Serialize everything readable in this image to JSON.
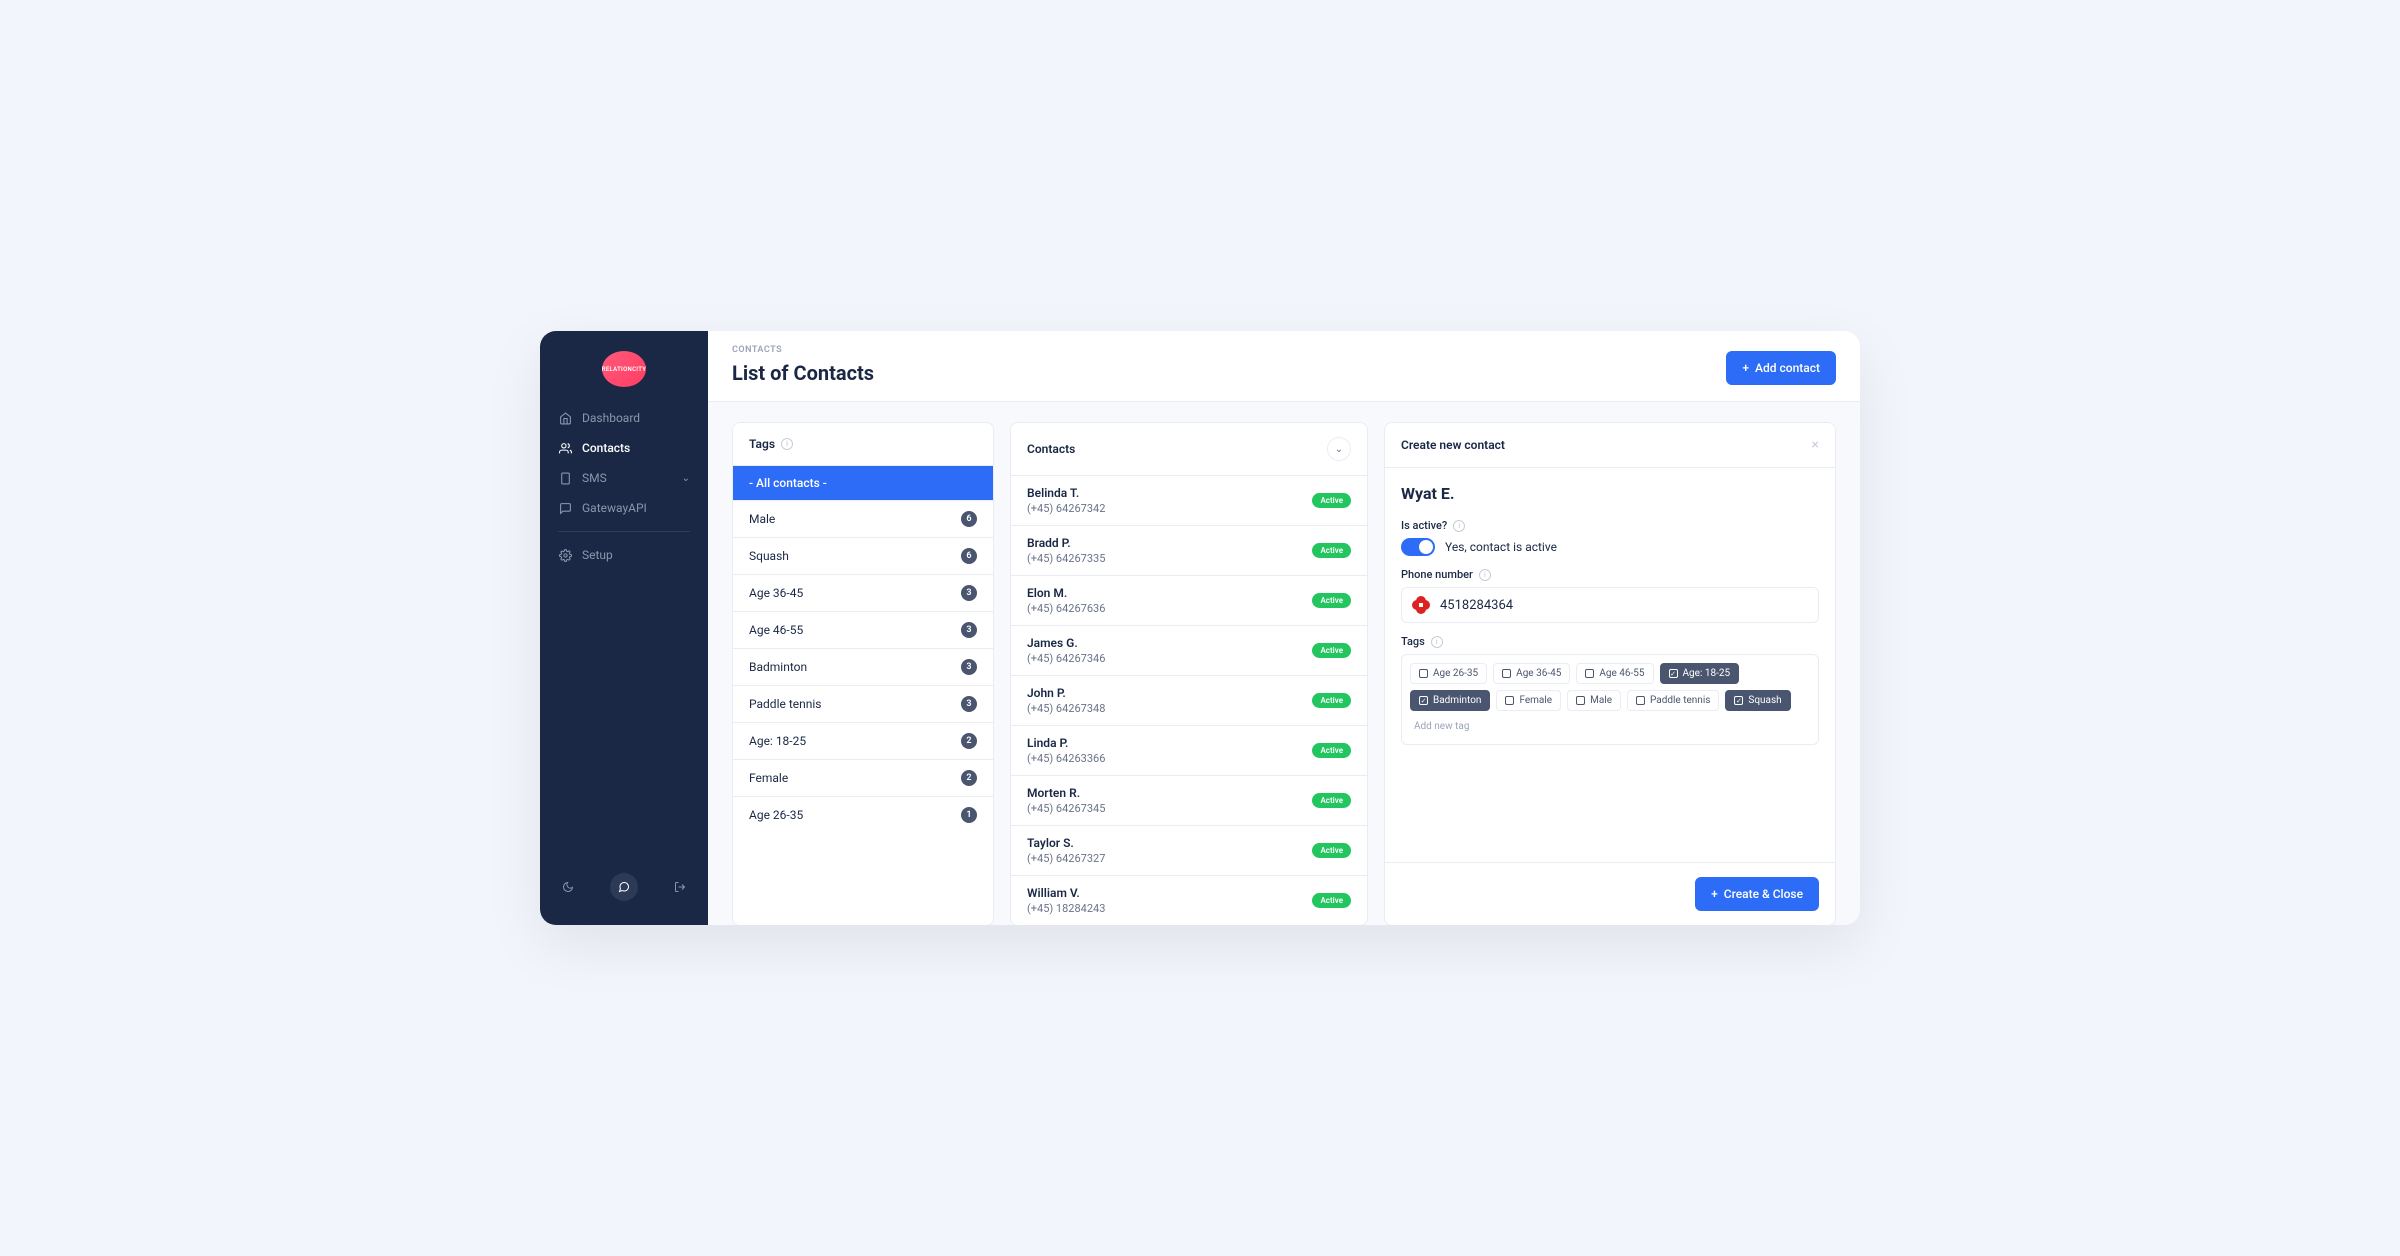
{
  "brand": "RELATIONCITY",
  "sidebar": {
    "items": [
      {
        "label": "Dashboard",
        "icon": "home"
      },
      {
        "label": "Contacts",
        "icon": "people",
        "active": true
      },
      {
        "label": "SMS",
        "icon": "phone",
        "expandable": true
      },
      {
        "label": "GatewayAPI",
        "icon": "chat"
      }
    ],
    "setup": "Setup"
  },
  "header": {
    "breadcrumb": "CONTACTS",
    "title": "List of Contacts",
    "add_button": "Add contact"
  },
  "tags_panel": {
    "title": "Tags",
    "items": [
      {
        "label": "- All contacts -",
        "active": true
      },
      {
        "label": "Male",
        "count": "6"
      },
      {
        "label": "Squash",
        "count": "6"
      },
      {
        "label": "Age 36-45",
        "count": "3"
      },
      {
        "label": "Age 46-55",
        "count": "3"
      },
      {
        "label": "Badminton",
        "count": "3"
      },
      {
        "label": "Paddle tennis",
        "count": "3"
      },
      {
        "label": "Age: 18-25",
        "count": "2"
      },
      {
        "label": "Female",
        "count": "2"
      },
      {
        "label": "Age 26-35",
        "count": "1"
      }
    ]
  },
  "contacts_panel": {
    "title": "Contacts",
    "items": [
      {
        "name": "Belinda T.",
        "phone": "(+45) 64267342",
        "status": "Active"
      },
      {
        "name": "Bradd P.",
        "phone": "(+45) 64267335",
        "status": "Active"
      },
      {
        "name": "Elon M.",
        "phone": "(+45) 64267636",
        "status": "Active"
      },
      {
        "name": "James G.",
        "phone": "(+45) 64267346",
        "status": "Active"
      },
      {
        "name": "John P.",
        "phone": "(+45) 64267348",
        "status": "Active"
      },
      {
        "name": "Linda P.",
        "phone": "(+45) 64263366",
        "status": "Active"
      },
      {
        "name": "Morten R.",
        "phone": "(+45) 64267345",
        "status": "Active"
      },
      {
        "name": "Taylor S.",
        "phone": "(+45) 64267327",
        "status": "Active"
      },
      {
        "name": "William V.",
        "phone": "(+45) 18284243",
        "status": "Active"
      }
    ]
  },
  "detail": {
    "panel_title": "Create new contact",
    "name": "Wyat E.",
    "active_label": "Is active?",
    "toggle_text": "Yes, contact is active",
    "phone_label": "Phone number",
    "phone_value": "4518284364",
    "tags_label": "Tags",
    "tags": [
      {
        "label": "Age 26-35",
        "selected": false
      },
      {
        "label": "Age 36-45",
        "selected": false
      },
      {
        "label": "Age 46-55",
        "selected": false
      },
      {
        "label": "Age: 18-25",
        "selected": true
      },
      {
        "label": "Badminton",
        "selected": true
      },
      {
        "label": "Female",
        "selected": false
      },
      {
        "label": "Male",
        "selected": false
      },
      {
        "label": "Paddle tennis",
        "selected": false
      },
      {
        "label": "Squash",
        "selected": true
      }
    ],
    "add_tag_placeholder": "Add new tag",
    "submit": "Create & Close"
  }
}
